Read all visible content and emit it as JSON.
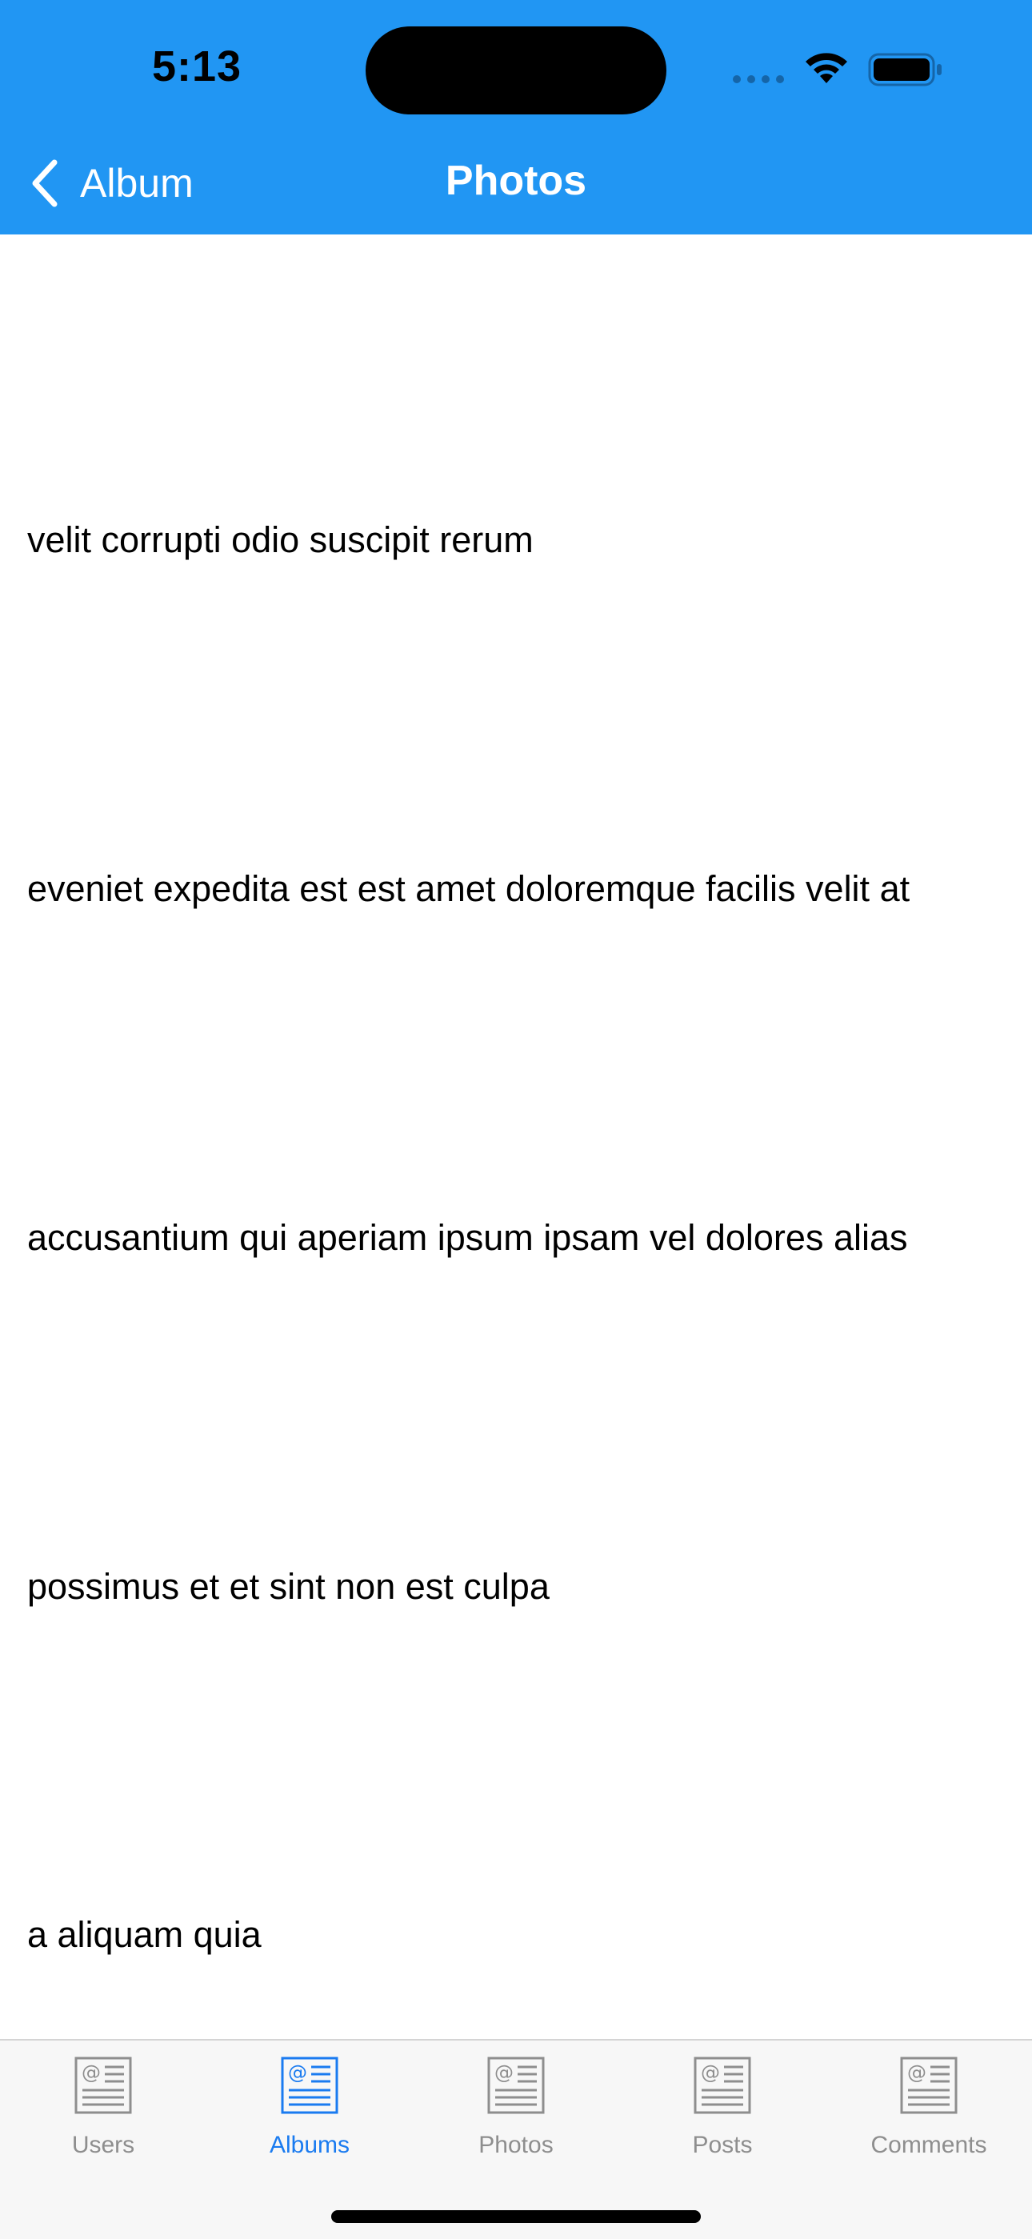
{
  "status_bar": {
    "time": "5:13"
  },
  "nav": {
    "back_label": "Album",
    "title": "Photos",
    "bar_color": "#2196F3"
  },
  "photos": [
    {
      "title": "velit corrupti odio suscipit rerum"
    },
    {
      "title": "eveniet expedita est est amet doloremque facilis velit at"
    },
    {
      "title": "accusantium qui aperiam ipsum ipsam vel dolores alias"
    },
    {
      "title": "possimus et et sint non est culpa"
    },
    {
      "title": "a aliquam quia"
    }
  ],
  "tab_bar": {
    "active_tab": "Albums",
    "active_color": "#1a7bf0",
    "inactive_color": "#8e8e8e",
    "tabs": [
      {
        "label": "Users",
        "icon": "contact-card-icon"
      },
      {
        "label": "Albums",
        "icon": "contact-card-icon"
      },
      {
        "label": "Photos",
        "icon": "contact-card-icon"
      },
      {
        "label": "Posts",
        "icon": "contact-card-icon"
      },
      {
        "label": "Comments",
        "icon": "contact-card-icon"
      }
    ]
  }
}
